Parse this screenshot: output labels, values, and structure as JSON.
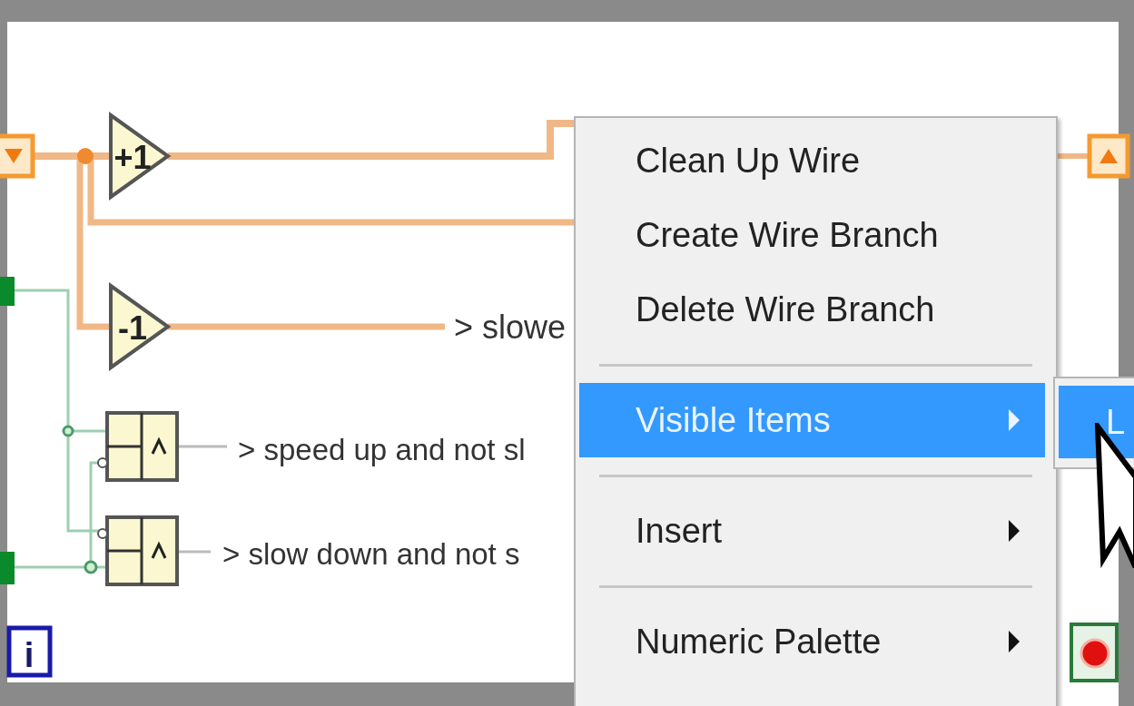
{
  "diagram": {
    "nodes": [
      {
        "label": "+1"
      },
      {
        "label": "-1"
      }
    ],
    "wire_labels": [
      "> slowe",
      "> speed up and not sl",
      "> slow down and not s"
    ],
    "iteration_terminal": {
      "label": "i"
    }
  },
  "context_menu": {
    "items": [
      {
        "kind": "item",
        "label": "Clean Up Wire",
        "submenu": false,
        "selected": false
      },
      {
        "kind": "item",
        "label": "Create Wire Branch",
        "submenu": false,
        "selected": false
      },
      {
        "kind": "item",
        "label": "Delete Wire Branch",
        "submenu": false,
        "selected": false
      },
      {
        "kind": "separator"
      },
      {
        "kind": "item",
        "label": "Visible Items",
        "submenu": true,
        "selected": true
      },
      {
        "kind": "separator"
      },
      {
        "kind": "item",
        "label": "Insert",
        "submenu": true,
        "selected": false
      },
      {
        "kind": "separator"
      },
      {
        "kind": "item",
        "label": "Numeric Palette",
        "submenu": true,
        "selected": false
      }
    ]
  },
  "submenu": {
    "items": [
      {
        "label": "L",
        "selected": true
      }
    ]
  }
}
